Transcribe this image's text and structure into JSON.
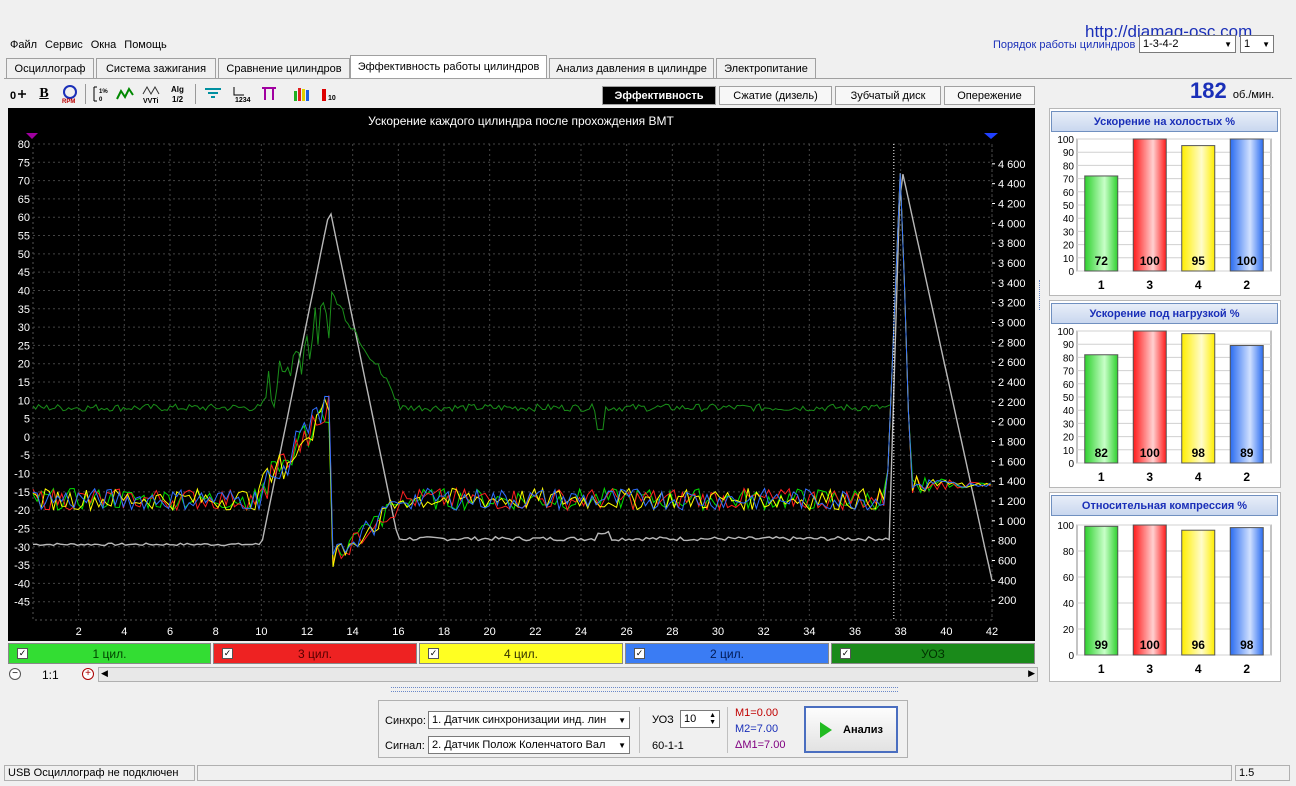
{
  "menu": [
    "Файл",
    "Сервис",
    "Окна",
    "Помощь"
  ],
  "watermark": "http://diamag-osc.com",
  "firing_order": {
    "label": "Порядок работы цилиндров",
    "value": "1-3-4-2",
    "second": "1"
  },
  "tabs": [
    "Осциллограф",
    "Система зажигания",
    "Сравнение цилиндров",
    "Эффективность работы цилиндров",
    "Анализ давления в цилиндре",
    "Электропитание"
  ],
  "active_tab": "Эффективность работы цилиндров",
  "toolbar_icons": [
    "pointer-icon",
    "bold-b-icon",
    "rpm-icon",
    "scale-icon",
    "wave-icon",
    "vvti-icon",
    "alg-icon",
    "filter-icon",
    "numbers-icon",
    "marker-icon",
    "bars-icon",
    "scale10-icon"
  ],
  "subtabs": [
    "Эффективность",
    "Сжатие (дизель)",
    "Зубчатый диск",
    "Опережение"
  ],
  "active_subtab": "Эффективность",
  "rpm": {
    "value": "182",
    "unit": "об./мин."
  },
  "chart_data": {
    "type": "line",
    "title": "Ускорение каждого цилиндра после прохождения ВМТ",
    "x": {
      "ticks": [
        2,
        4,
        6,
        8,
        10,
        12,
        14,
        16,
        18,
        20,
        22,
        24,
        26,
        28,
        30,
        32,
        34,
        36,
        38,
        40,
        42
      ],
      "range": [
        0,
        42
      ]
    },
    "y_left": {
      "ticks": [
        80,
        75,
        70,
        65,
        60,
        55,
        50,
        45,
        40,
        35,
        30,
        25,
        20,
        15,
        10,
        5,
        0,
        -5,
        -10,
        -15,
        -20,
        -25,
        -30,
        -35,
        -40,
        -45
      ],
      "range": [
        -50,
        80
      ]
    },
    "y_right": {
      "ticks": [
        "4 600",
        "4 400",
        "4 200",
        "4 000",
        "3 800",
        "3 600",
        "3 400",
        "3 200",
        "3 000",
        "2 800",
        "2 600",
        "2 400",
        "2 200",
        "2 000",
        "1 800",
        "1 600",
        "1 400",
        "1 200",
        "1 000",
        "800",
        "600",
        "400",
        "200"
      ],
      "range": [
        0,
        4800
      ]
    },
    "series": [
      {
        "name": "1 цил.",
        "color": "#00dd00"
      },
      {
        "name": "3 цил.",
        "color": "#ff2020"
      },
      {
        "name": "4 цил.",
        "color": "#ffff00"
      },
      {
        "name": "2 цил.",
        "color": "#3070ff"
      },
      {
        "name": "УОЗ",
        "color": "#1a8f1a"
      }
    ]
  },
  "cylinder_bar": [
    {
      "label": "1 цил.",
      "bg": "#33dd33",
      "fg": "#004400"
    },
    {
      "label": "3 цил.",
      "bg": "#ee2222",
      "fg": "#550000"
    },
    {
      "label": "4 цил.",
      "bg": "#ffff22",
      "fg": "#333300"
    },
    {
      "label": "2 цил.",
      "bg": "#3a7cf4",
      "fg": "#001a55"
    },
    {
      "label": "УОЗ",
      "bg": "#1a8a1a",
      "fg": "#003300"
    }
  ],
  "zoom": "1:1",
  "panels": [
    {
      "title": "Ускорение на холостых %",
      "ticks": [
        100,
        90,
        80,
        70,
        60,
        50,
        40,
        30,
        20,
        10,
        0
      ],
      "bars": [
        {
          "cyl": "1",
          "value": 72
        },
        {
          "cyl": "3",
          "value": 100
        },
        {
          "cyl": "4",
          "value": 95
        },
        {
          "cyl": "2",
          "value": 100
        }
      ]
    },
    {
      "title": "Ускорение под нагрузкой %",
      "ticks": [
        100,
        90,
        80,
        70,
        60,
        50,
        40,
        30,
        20,
        10,
        0
      ],
      "bars": [
        {
          "cyl": "1",
          "value": 82
        },
        {
          "cyl": "3",
          "value": 100
        },
        {
          "cyl": "4",
          "value": 98
        },
        {
          "cyl": "2",
          "value": 89
        }
      ]
    },
    {
      "title": "Относительная компрессия %",
      "ticks": [
        100,
        80,
        60,
        40,
        20,
        0
      ],
      "bars": [
        {
          "cyl": "1",
          "value": 99
        },
        {
          "cyl": "3",
          "value": 100
        },
        {
          "cyl": "4",
          "value": 96
        },
        {
          "cyl": "2",
          "value": 98
        }
      ]
    }
  ],
  "bottom": {
    "sync_label": "Синхро:",
    "sync_value": "1.  Датчик синхронизации инд. лин",
    "signal_label": "Сигнал:",
    "signal_value": "2.  Датчик Полож Коленчатого Вал",
    "uoz_label": "УОЗ",
    "uoz_value": "10",
    "teeth": "60-1-1",
    "m1": "M1=0.00",
    "m2": "M2=7.00",
    "dm": "ΔM1=7.00",
    "analyze": "Анализ"
  },
  "status": {
    "left": "USB Осциллограф не подключен",
    "right": "1.5"
  }
}
